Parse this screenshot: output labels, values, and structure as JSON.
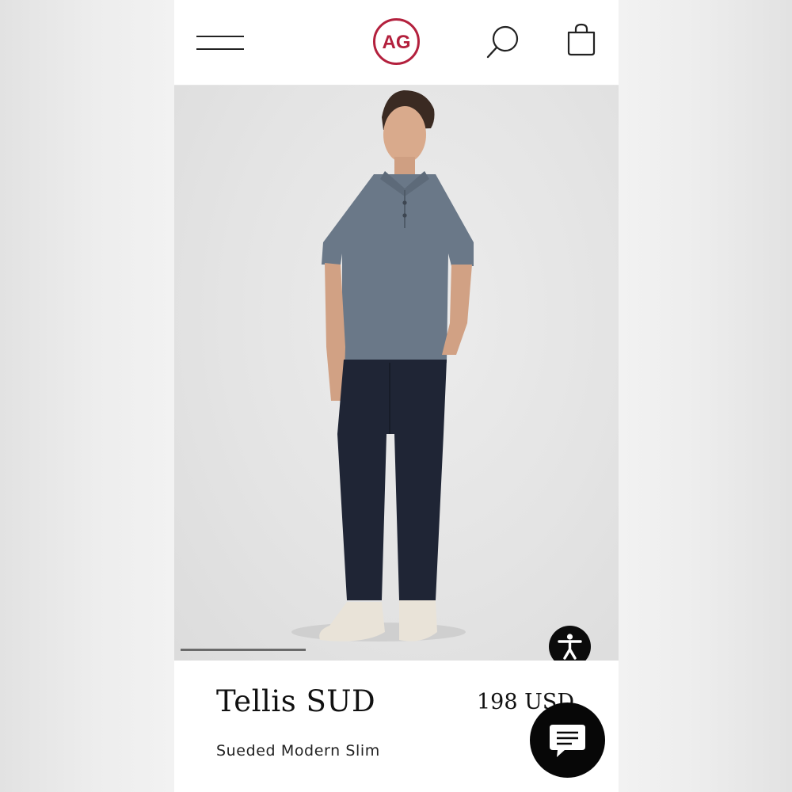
{
  "header": {
    "logo_text": "AG",
    "menu_icon": "hamburger-menu-icon",
    "search_icon": "search-icon",
    "bag_icon": "shopping-bag-icon",
    "brand_color": "#b3203d"
  },
  "gallery": {
    "image_subject": "product-model-photo",
    "accessibility_icon": "accessibility-icon"
  },
  "product": {
    "name": "Tellis SUD",
    "price": "198 USD",
    "subtitle": "Sueded Modern Slim"
  },
  "chat": {
    "icon": "chat-bubble-icon"
  }
}
